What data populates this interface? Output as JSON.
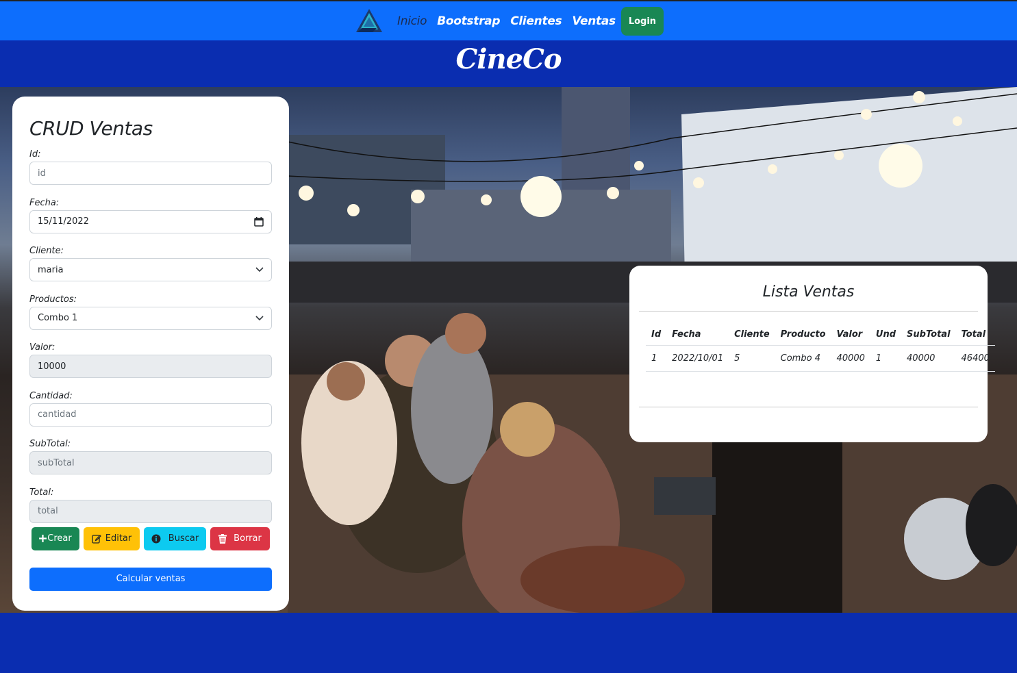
{
  "navbar": {
    "logo_icon": "triangle-logo-icon",
    "links": [
      "Inicio",
      "Bootstrap",
      "Clientes",
      "Ventas"
    ],
    "login_label": "Login"
  },
  "brand": "CineCo",
  "crud": {
    "title": "CRUD Ventas",
    "fields": {
      "id": {
        "label": "Id:",
        "placeholder": "id"
      },
      "fecha": {
        "label": "Fecha:",
        "value": "15/11/2022"
      },
      "cliente": {
        "label": "Cliente:",
        "value": "maria"
      },
      "productos": {
        "label": "Productos:",
        "value": "Combo 1"
      },
      "valor": {
        "label": "Valor:",
        "value": "10000"
      },
      "cantidad": {
        "label": "Cantidad:",
        "placeholder": "cantidad"
      },
      "subtotal": {
        "label": "SubTotal:",
        "placeholder": "subTotal"
      },
      "total": {
        "label": "Total:",
        "placeholder": "total"
      }
    },
    "buttons": {
      "crear": "Crear",
      "editar": "Editar",
      "buscar": "Buscar",
      "borrar": "Borrar",
      "calcular": "Calcular ventas"
    }
  },
  "lista": {
    "title": "Lista Ventas",
    "columns": [
      "Id",
      "Fecha",
      "Cliente",
      "Producto",
      "Valor",
      "Und",
      "SubTotal",
      "Total"
    ],
    "rows": [
      [
        "1",
        "2022/10/01",
        "5",
        "Combo 4",
        "40000",
        "1",
        "40000",
        "46400"
      ]
    ]
  },
  "colors": {
    "navbar": "#0d6efd",
    "brand_bar": "#0a2db0",
    "success": "#198754",
    "warning": "#ffc107",
    "info": "#0dcaf0",
    "danger": "#dc3545"
  }
}
